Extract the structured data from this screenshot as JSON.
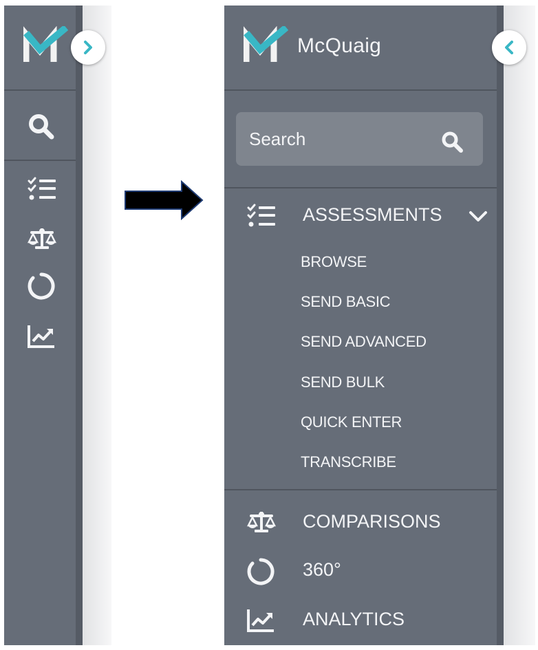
{
  "collapsed": {
    "brand_letter": "M",
    "toggle_icon": "chevron-right-icon",
    "icons": [
      "search-icon",
      "checklist-icon",
      "scale-icon",
      "circle-progress-icon",
      "chart-line-icon"
    ]
  },
  "transition_arrow_icon": "arrow-right-icon",
  "expanded": {
    "brand_name": "McQuaig",
    "toggle_icon": "chevron-left-icon",
    "search": {
      "placeholder": "Search",
      "icon": "search-icon"
    },
    "menu": [
      {
        "label": "ASSESSMENTS",
        "icon": "checklist-icon",
        "expanded": true,
        "children": [
          "BROWSE",
          "SEND BASIC",
          "SEND ADVANCED",
          "SEND BULK",
          "QUICK ENTER",
          "TRANSCRIBE"
        ]
      },
      {
        "label": "COMPARISONS",
        "icon": "scale-icon"
      },
      {
        "label": "360°",
        "icon": "circle-progress-icon"
      },
      {
        "label": "ANALYTICS",
        "icon": "chart-line-icon"
      }
    ]
  },
  "colors": {
    "sidebar_bg": "#666d78",
    "sidebar_edge": "#555b65",
    "search_bg": "#7f858e",
    "logo_teal": "#39b7c5",
    "logo_white": "#f2f2f2",
    "text": "#f3f4f6",
    "arrow": "#000000"
  }
}
